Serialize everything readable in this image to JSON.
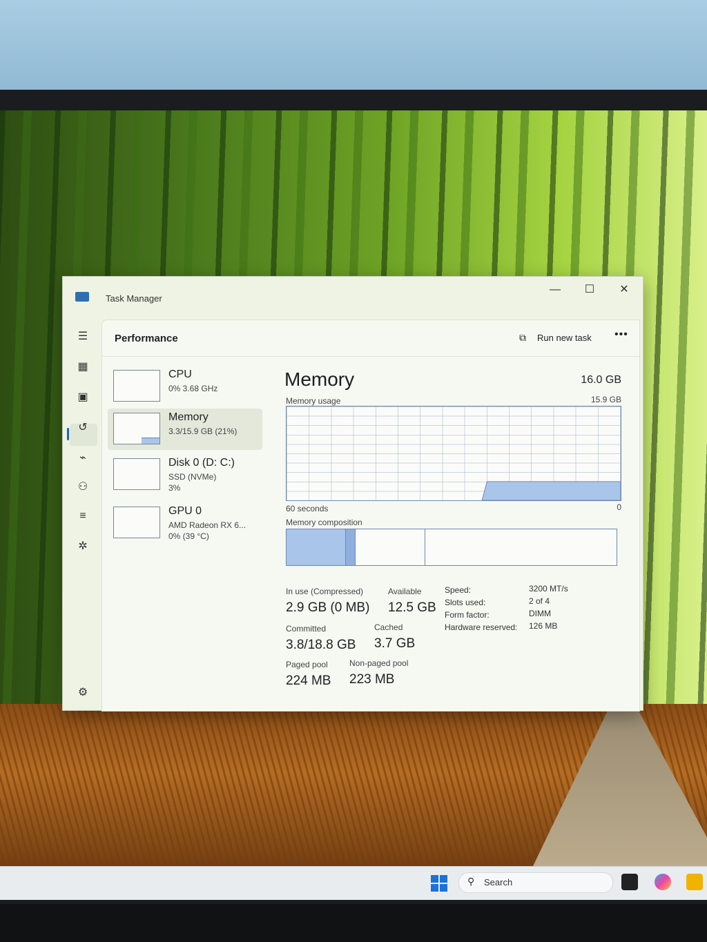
{
  "window": {
    "title": "Task Manager",
    "controls": {
      "minimize": "—",
      "maximize": "☐",
      "close": "✕"
    }
  },
  "header": {
    "page_title": "Performance",
    "run_new_task": "Run new task",
    "more": "•••"
  },
  "devices": [
    {
      "name": "CPU",
      "line1": "0% 3.68 GHz",
      "line2": ""
    },
    {
      "name": "Memory",
      "line1": "3.3/15.9 GB (21%)",
      "line2": ""
    },
    {
      "name": "Disk 0 (D: C:)",
      "line1": "SSD (NVMe)",
      "line2": "3%"
    },
    {
      "name": "GPU 0",
      "line1": "AMD Radeon RX 6...",
      "line2": "0% (39 °C)"
    }
  ],
  "memory": {
    "title": "Memory",
    "total": "16.0 GB",
    "usage_label": "Memory usage",
    "graph_max": "15.9 GB",
    "time_label": "60 seconds",
    "graph_min": "0",
    "composition_label": "Memory composition",
    "usage_fraction": 0.21,
    "composition": {
      "in_use": 0.18,
      "modified": 0.03,
      "standby": 0.21,
      "free": 0.58
    },
    "stats": {
      "in_use_label": "In use (Compressed)",
      "in_use_value": "2.9 GB (0 MB)",
      "available_label": "Available",
      "available_value": "12.5 GB",
      "committed_label": "Committed",
      "committed_value": "3.8/18.8 GB",
      "cached_label": "Cached",
      "cached_value": "3.7 GB",
      "paged_label": "Paged pool",
      "paged_value": "224 MB",
      "nonpaged_label": "Non-paged pool",
      "nonpaged_value": "223 MB"
    },
    "info": [
      {
        "key": "Speed:",
        "value": "3200 MT/s"
      },
      {
        "key": "Slots used:",
        "value": "2 of 4"
      },
      {
        "key": "Form factor:",
        "value": "DIMM"
      },
      {
        "key": "Hardware reserved:",
        "value": "126 MB"
      }
    ]
  },
  "taskbar": {
    "search_placeholder": "Search"
  },
  "colors": {
    "accent": "#1a62c4",
    "graph_fill": "#a9c6ea",
    "graph_line": "#6f86b5"
  }
}
